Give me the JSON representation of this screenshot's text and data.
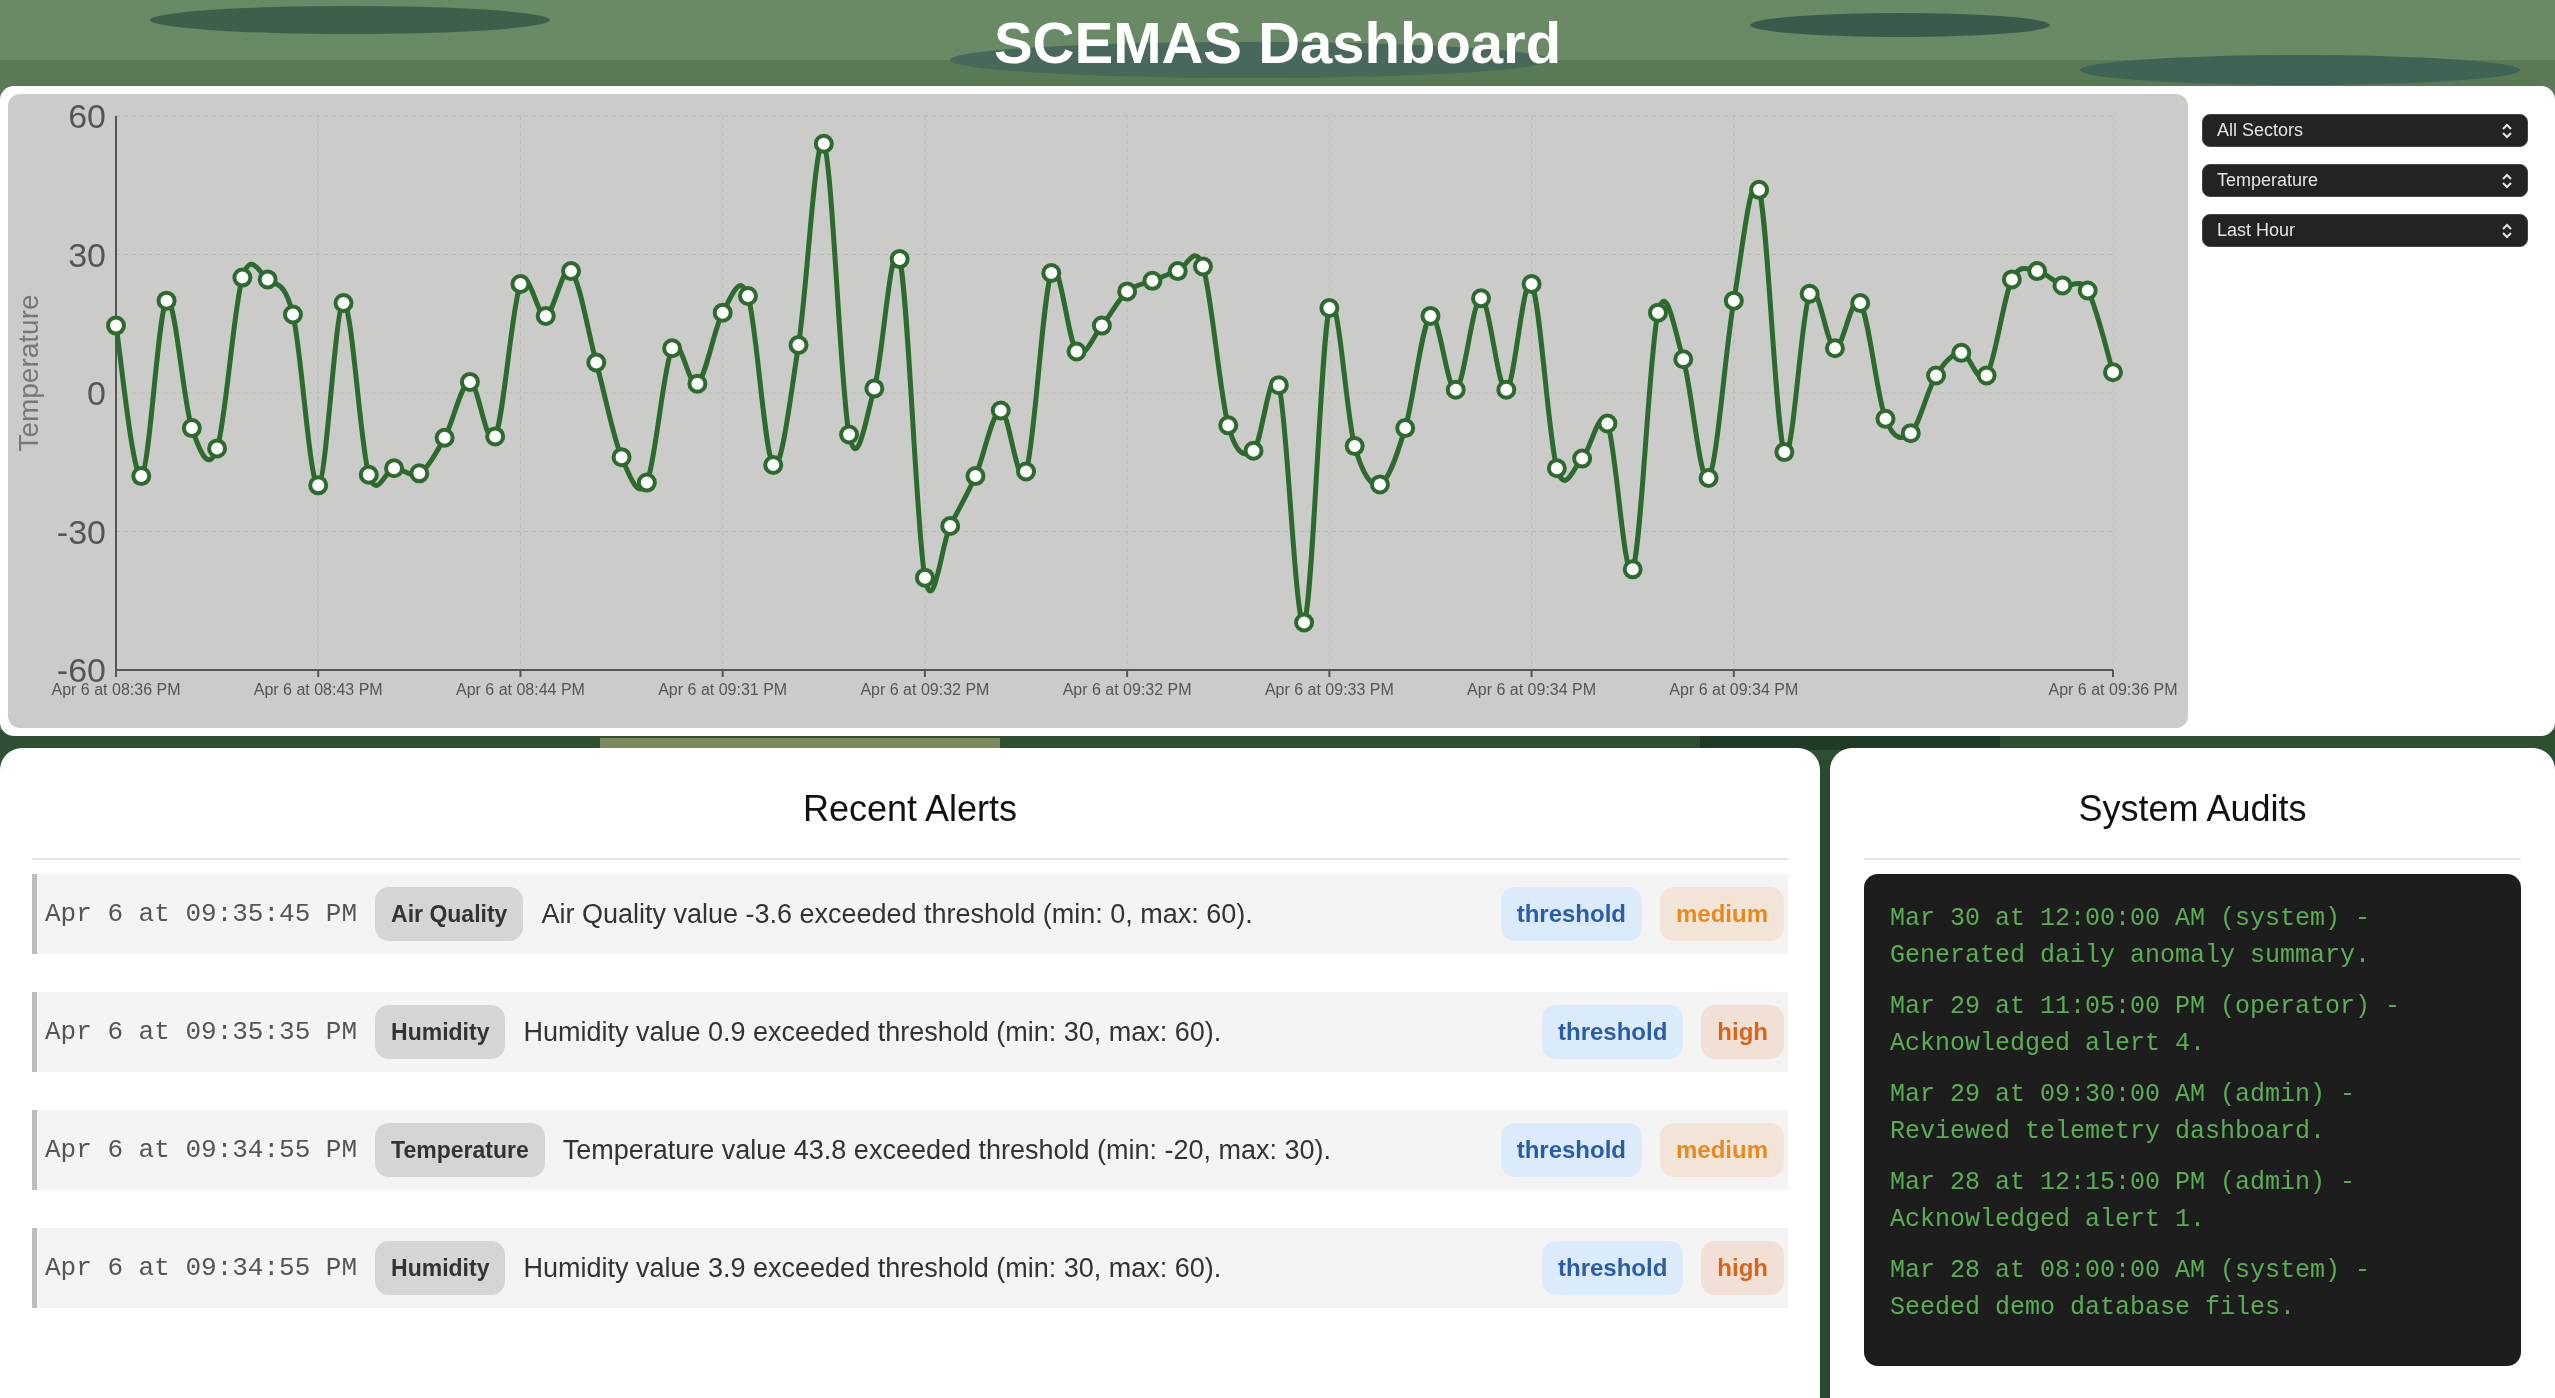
{
  "title": "SCEMAS Dashboard",
  "chart": {
    "chart_data": {
      "type": "line",
      "ylabel": "Temperature",
      "categories": [
        "Apr 6 at 08:36 PM",
        null,
        null,
        null,
        null,
        null,
        null,
        null,
        "Apr 6 at 08:43 PM",
        null,
        null,
        null,
        null,
        null,
        null,
        null,
        "Apr 6 at 08:44 PM",
        null,
        null,
        null,
        null,
        null,
        null,
        null,
        "Apr 6 at 09:31 PM",
        null,
        null,
        null,
        null,
        null,
        null,
        null,
        "Apr 6 at 09:32 PM",
        null,
        null,
        null,
        null,
        null,
        null,
        null,
        "Apr 6 at 09:32 PM",
        null,
        null,
        null,
        null,
        null,
        null,
        null,
        "Apr 6 at 09:33 PM",
        null,
        null,
        null,
        null,
        null,
        null,
        null,
        "Apr 6 at 09:34 PM",
        null,
        null,
        null,
        null,
        null,
        null,
        null,
        "Apr 6 at 09:34 PM",
        null,
        null,
        null,
        null,
        null,
        null,
        null,
        null,
        null,
        null,
        null,
        null,
        null,
        null,
        "Apr 6 at 09:36 PM"
      ],
      "series": [
        {
          "color": "#2d6a2d",
          "marker": "circle",
          "values": [
            14.6,
            -18,
            20,
            -7.6,
            -12,
            25,
            24.6,
            17,
            -20,
            19.5,
            -17.7,
            -16.3,
            -17.4,
            -9.7,
            2.4,
            -9.4,
            23.6,
            16.7,
            26.4,
            6.6,
            -13.9,
            -19.4,
            9.7,
            2,
            17.4,
            21,
            -15.6,
            10.4,
            54,
            -9,
            1,
            29,
            -40,
            -28.8,
            -18,
            -3.8,
            -17,
            26,
            9,
            14.6,
            22,
            24.3,
            26.4,
            27.4,
            -7,
            -12.5,
            1.7,
            -49.7,
            18.4,
            -11.5,
            -19.8,
            -7.6,
            16.7,
            0.7,
            20.5,
            0.7,
            23.6,
            -16.3,
            -14.2,
            -6.6,
            -38.2,
            17.4,
            7.3,
            -18.4,
            20,
            44,
            -12.8,
            21.5,
            9.7,
            19.5,
            -5.6,
            -8.7,
            3.8,
            8.7,
            3.8,
            24.6,
            26.4,
            23.3,
            22.2,
            4.5
          ]
        }
      ],
      "ylim": [
        -60,
        60
      ],
      "yticks": [
        -60,
        -30,
        0,
        30,
        60
      ],
      "grid": true
    }
  },
  "filters": [
    {
      "value": "All Sectors"
    },
    {
      "value": "Temperature"
    },
    {
      "value": "Last Hour"
    }
  ],
  "alerts": {
    "title": "Recent Alerts",
    "rows": [
      {
        "time": "Apr 6 at 09:35:45 PM",
        "category": "Air Quality",
        "message": "Air Quality value -3.6 exceeded threshold (min: 0, max: 60).",
        "type": "threshold",
        "severity": {
          "label": "medium",
          "color": "#e68a1f"
        }
      },
      {
        "time": "Apr 6 at 09:35:35 PM",
        "category": "Humidity",
        "message": "Humidity value 0.9 exceeded threshold (min: 30, max: 60).",
        "type": "threshold",
        "severity": {
          "label": "high",
          "color": "#d9651a"
        }
      },
      {
        "time": "Apr 6 at 09:34:55 PM",
        "category": "Temperature",
        "message": "Temperature value 43.8 exceeded threshold (min: -20, max: 30).",
        "type": "threshold",
        "severity": {
          "label": "medium",
          "color": "#e68a1f"
        }
      },
      {
        "time": "Apr 6 at 09:34:55 PM",
        "category": "Humidity",
        "message": "Humidity value 3.9 exceeded threshold (min: 30, max: 60).",
        "type": "threshold",
        "severity": {
          "label": "high",
          "color": "#d9651a"
        }
      }
    ]
  },
  "audits": {
    "title": "System Audits",
    "entries": [
      "Mar 30 at 12:00:00 AM (system) - Generated daily anomaly summary.",
      "Mar 29 at 11:05:00 PM (operator) - Acknowledged alert 4.",
      "Mar 29 at 09:30:00 AM (admin) - Reviewed telemetry dashboard.",
      "Mar 28 at 12:15:00 PM (admin) - Acknowledged alert 1.",
      "Mar 28 at 08:00:00 AM (system) - Seeded demo database files."
    ]
  }
}
